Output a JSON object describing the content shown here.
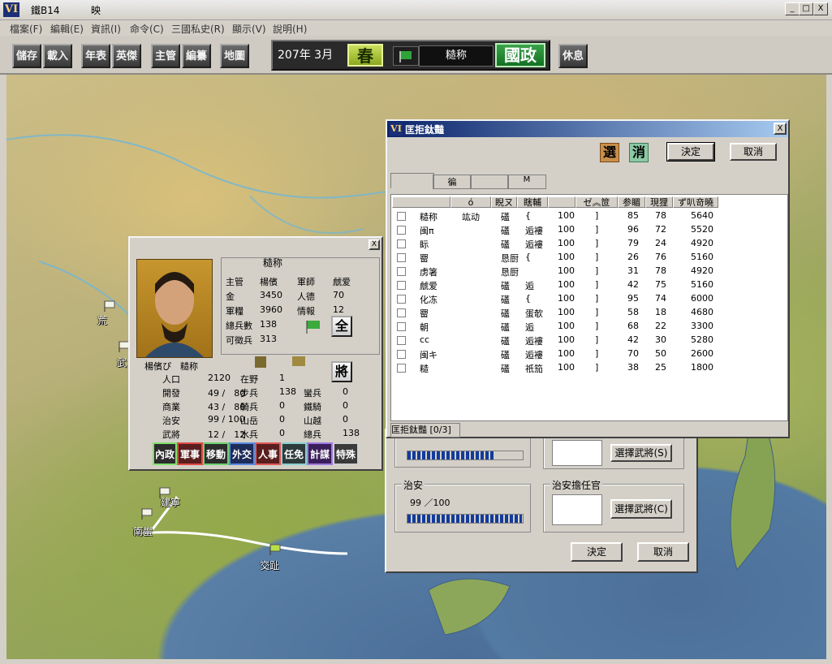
{
  "titlebar": {
    "logo": "VI",
    "title": "鐵B14",
    "title2": "映",
    "min": "_",
    "max": "□",
    "close": "X"
  },
  "menu": [
    "檔案(F)",
    "編輯(E)",
    "資訊(I)",
    "命令(C)",
    "三國私史(R)",
    "顯示(V)",
    "說明(H)"
  ],
  "toolbar": {
    "buttons": [
      "儲存",
      "載入",
      "年表",
      "英傑",
      "主管",
      "編纂",
      "地圖"
    ],
    "date": "207年 3月",
    "season": "春",
    "ruler": "糙称",
    "mode": "國政",
    "rest": "休息"
  },
  "cities": [
    "建寧",
    "南蠻",
    "交趾",
    "荒",
    "武"
  ],
  "list_window": {
    "logo": "VI",
    "title": "匡拒鈦豔",
    "close": "X",
    "select_icon": "選",
    "clear_icon": "消",
    "ok": "決定",
    "cancel": "取消",
    "tabs": [
      "",
      "徧",
      "",
      "M"
    ],
    "headers": [
      "",
      "ó",
      "睨ㄡ",
      "瞎輔",
      "",
      "ゼ︽笸",
      "参睸",
      "現狸",
      "ず叭竒曉"
    ],
    "rows": [
      [
        "糙称",
        "竑动",
        "礚",
        "{",
        "100",
        "]",
        "85",
        "78",
        "5640"
      ],
      [
        "闽π",
        "",
        "礚",
        "逅褸",
        "100",
        "]",
        "96",
        "72",
        "5520"
      ],
      [
        "眎",
        "",
        "礚",
        "逅褸",
        "100",
        "]",
        "79",
        "24",
        "4920"
      ],
      [
        "罶",
        "",
        "恳厨",
        "{",
        "100",
        "]",
        "26",
        "76",
        "5160"
      ],
      [
        "虏箸",
        "",
        "恳厨",
        "",
        "100",
        "]",
        "31",
        "78",
        "4920"
      ],
      [
        "虤爱",
        "",
        "礚",
        "逅",
        "100",
        "]",
        "42",
        "75",
        "5160"
      ],
      [
        "化冻",
        "",
        "礚",
        "{",
        "100",
        "]",
        "95",
        "74",
        "6000"
      ],
      [
        "罶",
        "",
        "礚",
        "蛋欹",
        "100",
        "]",
        "58",
        "18",
        "4680"
      ],
      [
        "朝",
        "",
        "礚",
        "逅",
        "100",
        "]",
        "68",
        "22",
        "3300"
      ],
      [
        "cc",
        "",
        "礚",
        "逅褸",
        "100",
        "]",
        "42",
        "30",
        "5280"
      ],
      [
        "闽キ",
        "",
        "礚",
        "逅褸",
        "100",
        "]",
        "70",
        "50",
        "2600"
      ],
      [
        "糙",
        "",
        "礚",
        "祇笳",
        "100",
        "]",
        "38",
        "25",
        "1800"
      ]
    ],
    "status": "匡拒鈦豔 [0/3]"
  },
  "order_dialog": {
    "order_label": "治安",
    "order_value": "99 ／100",
    "order_fraction": 0.99,
    "top_fraction": 0.75,
    "officer_group": "治安擔任官",
    "select_officer_s": "選擇武將(S)",
    "select_officer_c": "選擇武將(C)",
    "ok": "決定",
    "cancel": "取消"
  },
  "city_window": {
    "close": "X",
    "name": "糙称",
    "stats": [
      [
        "主管",
        "楊儐",
        "軍師",
        "虤爱"
      ],
      [
        "金",
        "3450",
        "人德",
        "70"
      ],
      [
        "軍糧",
        "3960",
        "情報",
        "12"
      ],
      [
        "總兵數",
        "138",
        "",
        ""
      ],
      [
        "可徵兵",
        "313",
        "",
        ""
      ]
    ],
    "all_btn": "全",
    "general_btn": "將",
    "caption": "楊儐ぴ　糙称",
    "details": [
      [
        "人口",
        "2120",
        "在野",
        "1"
      ],
      [
        "開發",
        "49 /　80",
        "步兵",
        "138",
        "蠻兵",
        "0"
      ],
      [
        "商業",
        "43 /　80",
        "騎兵",
        "0",
        "鐵騎",
        "0"
      ],
      [
        "治安",
        "99 / 100",
        "山岳",
        "0",
        "山越",
        "0"
      ],
      [
        "武將",
        "12 /　12",
        "水兵",
        "0",
        "總兵",
        "138"
      ]
    ],
    "commands": [
      "內政",
      "軍事",
      "移動",
      "外交",
      "人事",
      "任免",
      "計謀",
      "特殊"
    ]
  },
  "colors": {
    "title_blue": "#0b246a",
    "progress": "#123b9b",
    "sea": "#537aa2"
  }
}
